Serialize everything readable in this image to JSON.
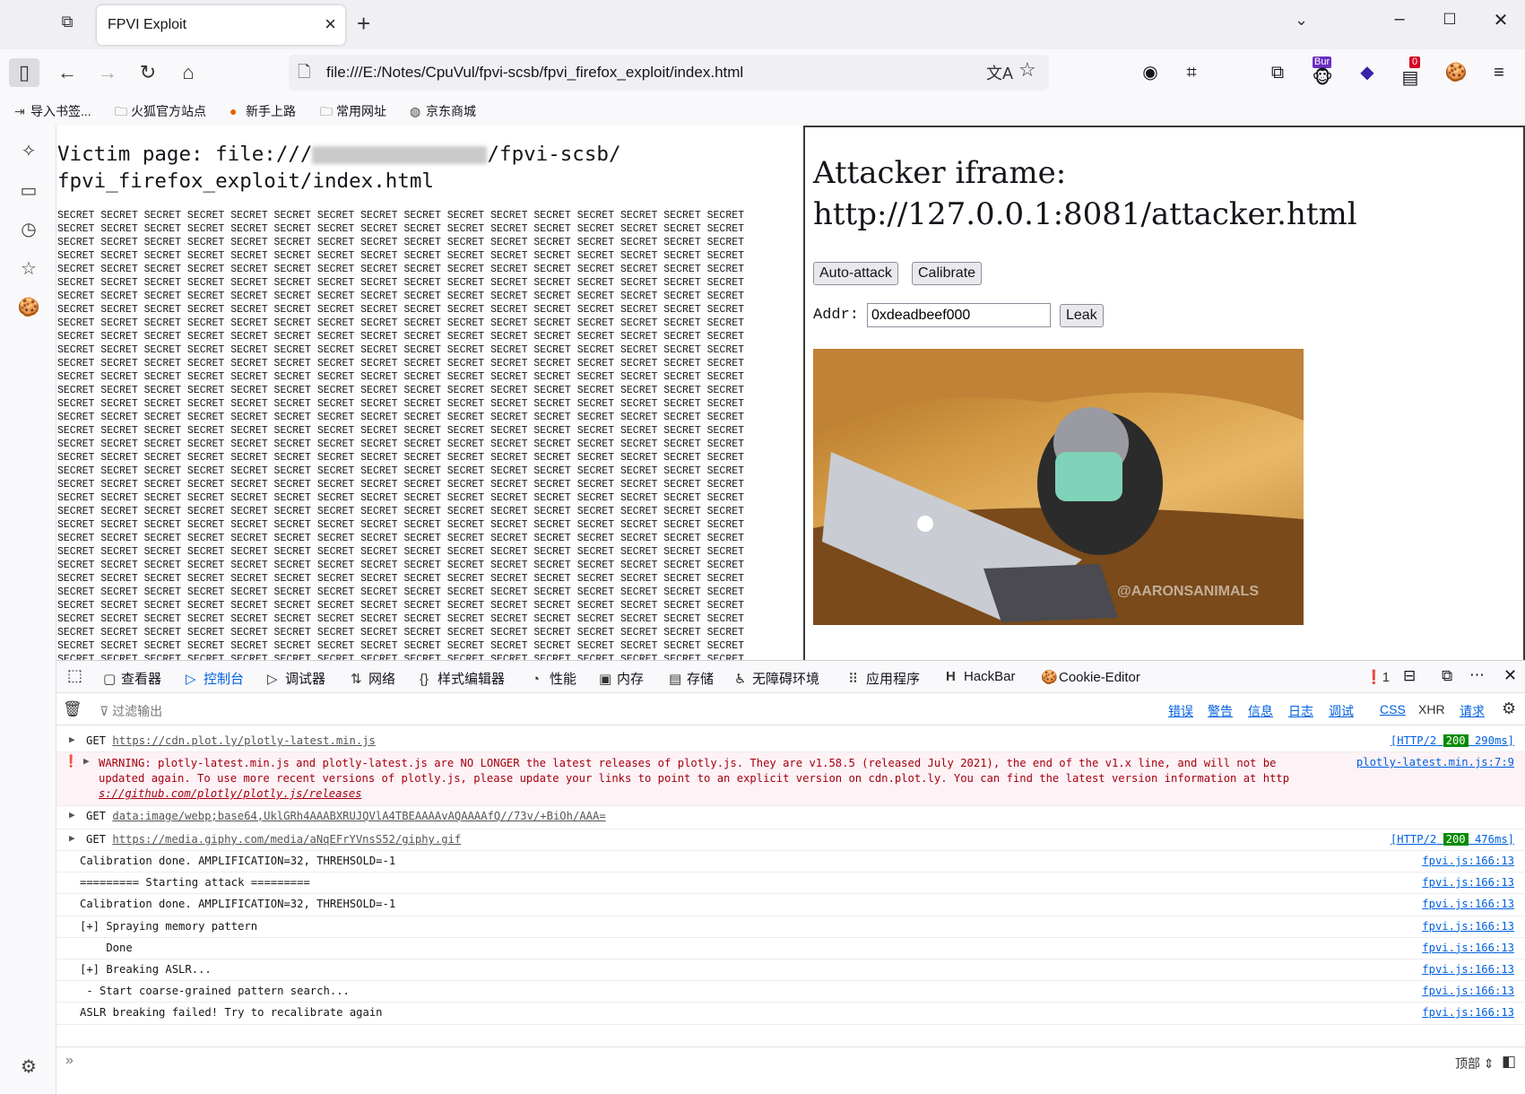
{
  "tab": {
    "title": "FPVI Exploit"
  },
  "url": "file:///E:/Notes/CpuVul/fpvi-scsb/fpvi_firefox_exploit/index.html",
  "extensions": {
    "burp_badge": "Bur",
    "ublock_badge": "0"
  },
  "bookmarks": [
    "导入书签...",
    "火狐官方站点",
    "新手上路",
    "常用网址",
    "京东商城"
  ],
  "victim": {
    "title_prefix": "Victim page: file:///",
    "title_suffix": "/fpvi-scsb/",
    "title_line2": "fpvi_firefox_exploit/index.html",
    "secret_word": "SECRET"
  },
  "attacker": {
    "title_line1": "Attacker iframe:",
    "title_line2": "http://127.0.0.1:8081/attacker.html",
    "auto_attack": "Auto-attack",
    "calibrate": "Calibrate",
    "addr_label": "Addr:",
    "addr_value": "0xdeadbeef000",
    "leak": "Leak",
    "watermark": "@AARONSANIMALS"
  },
  "devtools": {
    "tabs": [
      "查看器",
      "控制台",
      "调试器",
      "网络",
      "样式编辑器",
      "性能",
      "内存",
      "存储",
      "无障碍环境",
      "应用程序",
      "HackBar",
      "Cookie-Editor"
    ],
    "error_count": "1",
    "filter_placeholder": "过滤输出",
    "filters": [
      "错误",
      "警告",
      "信息",
      "日志",
      "调试"
    ],
    "req_filters": [
      "CSS",
      "XHR",
      "请求"
    ],
    "bottom_label": "顶部"
  },
  "console": {
    "get1": {
      "method": "GET",
      "url": "https://cdn.plot.ly/plotly-latest.min.js",
      "proto": "[HTTP/2",
      "status": "200",
      "time": "290ms]"
    },
    "warn": {
      "line1": "WARNING: plotly-latest.min.js and plotly-latest.js are NO LONGER the latest releases of plotly.js. They are v1.58.5 (released July 2021), the end of the v1.x line, and will not be",
      "line2": "updated again. To use more recent versions of plotly.js, please update your links to point to an explicit version on cdn.plot.ly. You can find the latest version information at http",
      "line3": "s://github.com/plotly/plotly.js/releases",
      "loc": "plotly-latest.min.js:7:9"
    },
    "get2": {
      "method": "GET",
      "url": "data:image/webp;base64,UklGRh4AAABXRUJQVlA4TBEAAAAvAQAAAAfQ//73v/+BiOh/AAA="
    },
    "get3": {
      "method": "GET",
      "url": "https://media.giphy.com/media/aNqEFrYVnsS52/giphy.gif",
      "proto": "[HTTP/2",
      "status": "200",
      "time": "476ms]"
    },
    "logs": [
      {
        "text": "Calibration done. AMPLIFICATION=32, THREHSOLD=-1",
        "loc": "fpvi.js:166:13"
      },
      {
        "text": "========= Starting attack =========",
        "loc": "fpvi.js:166:13"
      },
      {
        "text": "Calibration done. AMPLIFICATION=32, THREHSOLD=-1",
        "loc": "fpvi.js:166:13"
      },
      {
        "text": "[+] Spraying memory pattern",
        "loc": "fpvi.js:166:13"
      },
      {
        "text": "    Done",
        "loc": "fpvi.js:166:13"
      },
      {
        "text": "[+] Breaking ASLR...",
        "loc": "fpvi.js:166:13"
      },
      {
        "text": " - Start coarse-grained pattern search...",
        "loc": "fpvi.js:166:13"
      },
      {
        "text": "ASLR breaking failed! Try to recalibrate again",
        "loc": "fpvi.js:166:13"
      }
    ]
  }
}
